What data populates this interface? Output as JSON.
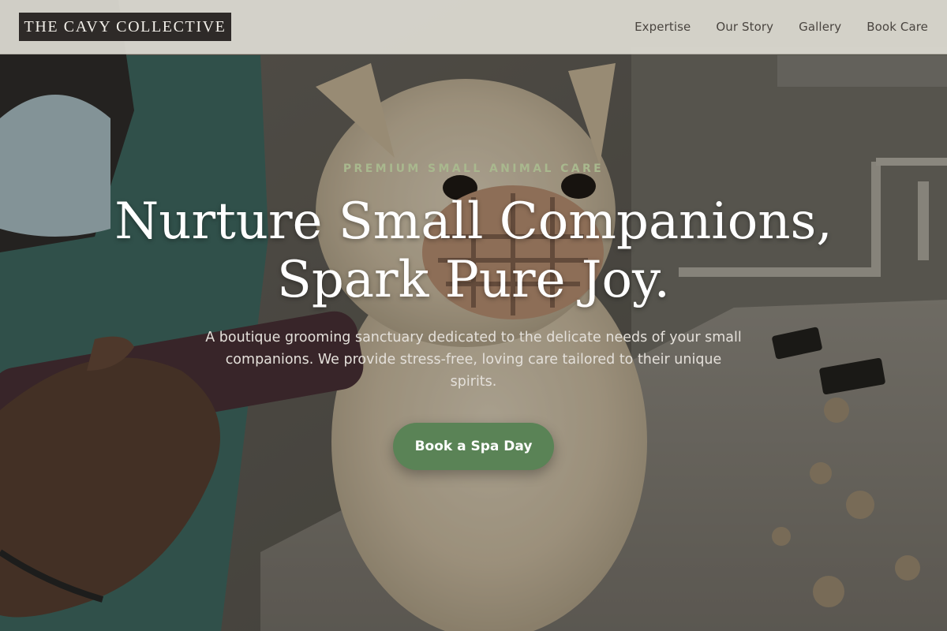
{
  "brand": {
    "logo_text": "THE CAVY COLLECTIVE"
  },
  "nav": {
    "items": [
      {
        "label": "Expertise"
      },
      {
        "label": "Our Story"
      },
      {
        "label": "Gallery"
      },
      {
        "label": "Book Care"
      }
    ]
  },
  "hero": {
    "eyebrow": "PREMIUM SMALL ANIMAL CARE",
    "headline_line1": "Nurture Small Companions,",
    "headline_line2": "Spark Pure Joy.",
    "description": "A boutique grooming sanctuary dedicated to the delicate needs of your small companions. We provide stress-free, loving care tailored to their unique spirits.",
    "cta_label": "Book a Spa Day",
    "background_image": "groomer-trimming-fluffy-dog-photo"
  },
  "colors": {
    "accent_green": "#5a8356",
    "eyebrow_sage": "#a9b88e",
    "header_bg": "#dedbd3",
    "logo_bg": "#2e2a28"
  }
}
